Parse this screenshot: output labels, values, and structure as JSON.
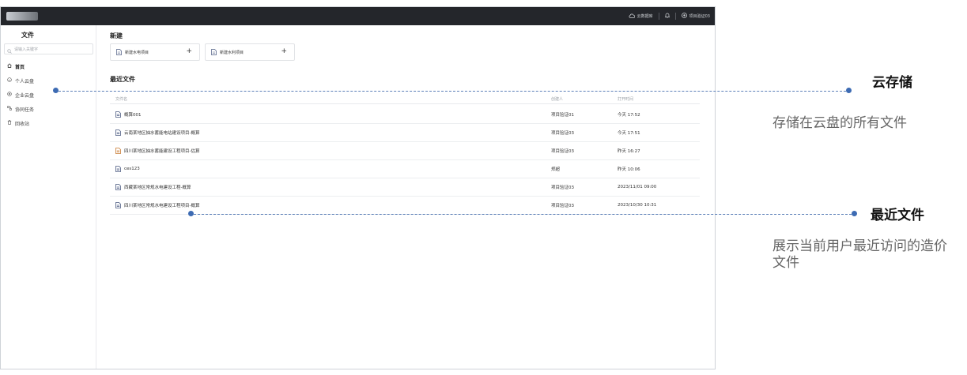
{
  "topbar": {
    "cloud_label": "云数据库",
    "user_label": "项目验证03"
  },
  "sidebar": {
    "title": "文件",
    "search_placeholder": "请输入关键字",
    "items": [
      {
        "label": "首页",
        "icon": "home-icon",
        "active": true
      },
      {
        "label": "个人云盘",
        "icon": "cloud-icon"
      },
      {
        "label": "企业云盘",
        "icon": "enterprise-icon"
      },
      {
        "label": "协同任务",
        "icon": "task-icon"
      },
      {
        "label": "回收站",
        "icon": "trash-icon"
      }
    ]
  },
  "main": {
    "new_heading": "新建",
    "new_cards": [
      {
        "label": "新建水电项目",
        "icon": "file-icon"
      },
      {
        "label": "新建水利项目",
        "icon": "file-icon"
      }
    ],
    "recent_heading": "最近文件",
    "columns": {
      "name": "文件名",
      "creator": "创建人",
      "time": "打开时间"
    },
    "rows": [
      {
        "name": "概算001",
        "creator": "项目验证01",
        "time": "今天 17:52",
        "icon_color": "#4a5a80"
      },
      {
        "name": "云南某地区抽水蓄能电站建设项目-概算",
        "creator": "项目验证03",
        "time": "今天 17:51",
        "icon_color": "#4a5a80"
      },
      {
        "name": "四川某地区抽水蓄能建设工程项目-估算",
        "creator": "项目验证03",
        "time": "昨天 16:27",
        "icon_color": "#c8782e"
      },
      {
        "name": "ces123",
        "creator": "郑超",
        "time": "昨天 10:06",
        "icon_color": "#4a5a80"
      },
      {
        "name": "西藏某地区常规水电建设工程-概算",
        "creator": "项目验证03",
        "time": "2023/11/01 09:00",
        "icon_color": "#4a5a80"
      },
      {
        "name": "四川某地区常规水电建设工程项目-概算",
        "creator": "项目验证03",
        "time": "2023/10/30 10:31",
        "icon_color": "#4a5a80"
      }
    ]
  },
  "annotations": [
    {
      "title": "云存储",
      "desc": "存储在云盘的所有文件"
    },
    {
      "title": "最近文件",
      "desc": "展示当前用户最近访问的造价文件"
    }
  ],
  "colors": {
    "topbar": "#24262b",
    "accent": "#3d6bb3"
  }
}
